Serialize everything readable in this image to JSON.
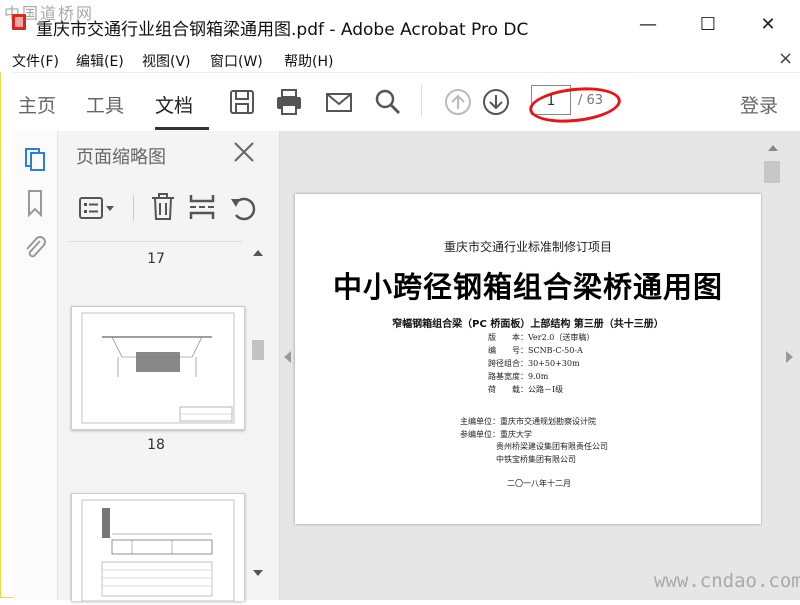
{
  "watermark": {
    "top": "中国道桥网",
    "bottom": "www.cndao.com"
  },
  "window": {
    "title": "重庆市交通行业组合钢箱梁通用图.pdf - Adobe Acrobat Pro DC",
    "minimize": "—",
    "maximize": "☐",
    "close": "✕"
  },
  "menu": [
    "文件(F)",
    "编辑(E)",
    "视图(V)",
    "窗口(W)",
    "帮助(H)"
  ],
  "menu_close": "×",
  "toolbar": {
    "tabs": [
      "主页",
      "工具",
      "文档"
    ],
    "active_tab": "文档",
    "page_current": "1",
    "page_total": "/ 63",
    "login": "登录"
  },
  "panel": {
    "title": "页面缩略图",
    "thumb_labels": [
      "17",
      "18"
    ]
  },
  "document": {
    "header": "重庆市交通行业标准制修订项目",
    "title": "中小跨径钢箱组合梁桥通用图",
    "subtitle": "窄幅钢箱组合梁（PC 桥面板）上部结构 第三册（共十三册）",
    "specs": [
      {
        "label": "版　　本：",
        "value": "Ver2.0（送审稿）"
      },
      {
        "label": "编　　号：",
        "value": "SCNB-C-50-A"
      },
      {
        "label": "跨径组合：",
        "value": "30+50+30m"
      },
      {
        "label": "路基宽度：",
        "value": "9.0m"
      },
      {
        "label": "荷　　载：",
        "value": "公路－Ⅰ级"
      }
    ],
    "editors": [
      {
        "label": "主编单位：",
        "value": "重庆市交通规划勘察设计院"
      },
      {
        "label": "参编单位：",
        "value": "重庆大学"
      },
      {
        "label": "",
        "value": "贵州桥梁建设集团有限责任公司"
      },
      {
        "label": "",
        "value": "中铁宝桥集团有限公司"
      }
    ],
    "date": "二〇一八年十二月"
  },
  "colors": {
    "accent": "#e11111",
    "active_blue": "#2d7fd3",
    "pdf_red": "#d9281f"
  }
}
